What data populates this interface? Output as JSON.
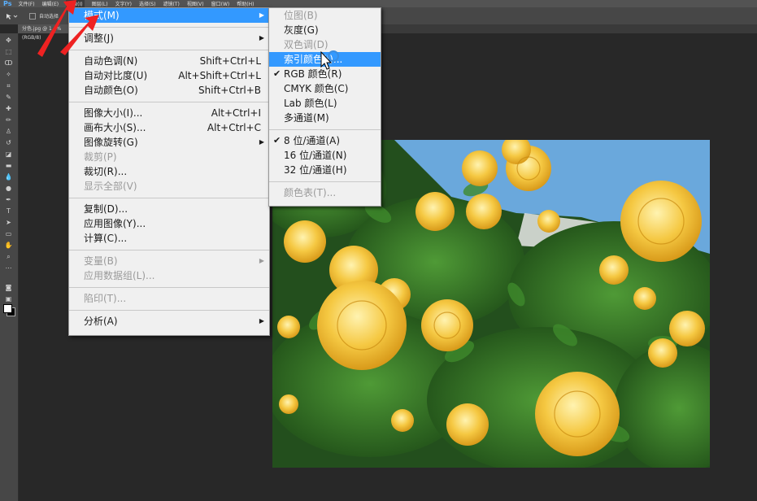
{
  "menubar": {
    "logo": "Ps",
    "items": [
      "文件(F)",
      "编辑(E)",
      "图像(I)",
      "图层(L)",
      "文字(Y)",
      "选择(S)",
      "滤镜(T)",
      "视图(V)",
      "窗口(W)",
      "帮助(H)"
    ]
  },
  "options": {
    "auto_select": "自动选择"
  },
  "document": {
    "tab": "分色.jpg @ 1...%(RGB/8)"
  },
  "image_menu": {
    "mode": "模式(M)",
    "adjust": "调整(J)",
    "auto_tone": "自动色调(N)",
    "auto_tone_sc": "Shift+Ctrl+L",
    "auto_contrast": "自动对比度(U)",
    "auto_contrast_sc": "Alt+Shift+Ctrl+L",
    "auto_color": "自动颜色(O)",
    "auto_color_sc": "Shift+Ctrl+B",
    "image_size": "图像大小(I)...",
    "image_size_sc": "Alt+Ctrl+I",
    "canvas_size": "画布大小(S)...",
    "canvas_size_sc": "Alt+Ctrl+C",
    "rotate": "图像旋转(G)",
    "crop": "裁剪(P)",
    "trim": "裁切(R)...",
    "reveal_all": "显示全部(V)",
    "duplicate": "复制(D)...",
    "apply_image": "应用图像(Y)...",
    "calculations": "计算(C)...",
    "variables": "变量(B)",
    "apply_dataset": "应用数据组(L)...",
    "trap": "陷印(T)...",
    "analysis": "分析(A)"
  },
  "mode_menu": {
    "bitmap": "位图(B)",
    "grayscale": "灰度(G)",
    "duotone": "双色调(D)",
    "indexed": "索引颜色(I)...",
    "rgb": "RGB 颜色(R)",
    "cmyk": "CMYK 颜色(C)",
    "lab": "Lab 颜色(L)",
    "multichannel": "多通道(M)",
    "bit8": "8 位/通道(A)",
    "bit16": "16 位/通道(N)",
    "bit32": "32 位/通道(H)",
    "color_table": "颜色表(T)...",
    "check": "✔"
  },
  "colors": {
    "highlight": "#3399ff",
    "menu_bg": "#f0f0f0",
    "arrow": "#ee2222"
  }
}
